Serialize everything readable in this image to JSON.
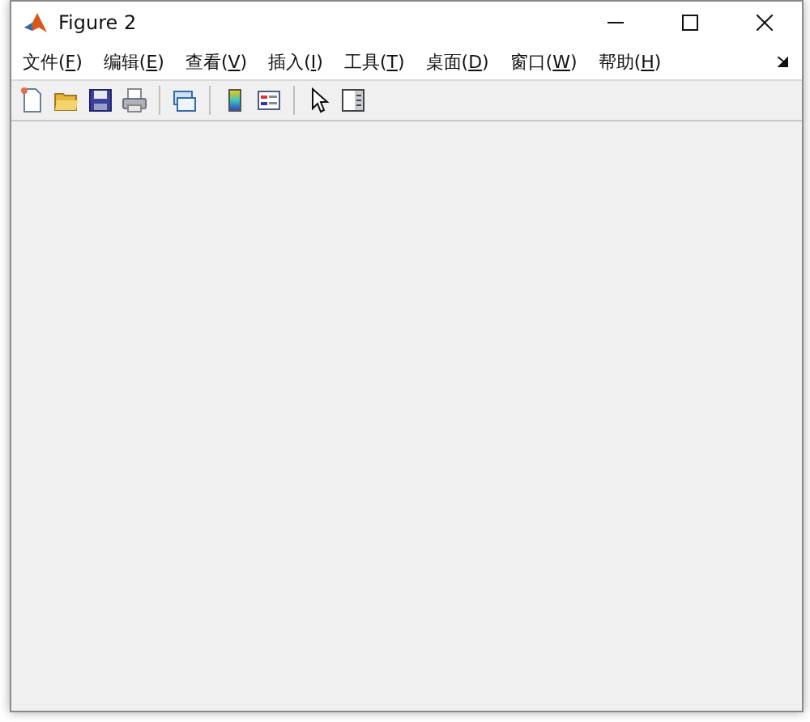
{
  "window": {
    "title": "Figure 2"
  },
  "menu": [
    {
      "label": "文件(F)"
    },
    {
      "label": "编辑(E)"
    },
    {
      "label": "查看(V)"
    },
    {
      "label": "插入(I)"
    },
    {
      "label": "工具(T)"
    },
    {
      "label": "桌面(D)"
    },
    {
      "label": "窗口(W)"
    },
    {
      "label": "帮助(H)"
    }
  ],
  "toolbar": [
    {
      "kind": "new"
    },
    {
      "kind": "open"
    },
    {
      "kind": "save"
    },
    {
      "kind": "print"
    },
    {
      "kind": "separator"
    },
    {
      "kind": "link"
    },
    {
      "kind": "separator"
    },
    {
      "kind": "colorbar"
    },
    {
      "kind": "legend"
    },
    {
      "kind": "separator"
    },
    {
      "kind": "pointer"
    },
    {
      "kind": "panel"
    }
  ]
}
